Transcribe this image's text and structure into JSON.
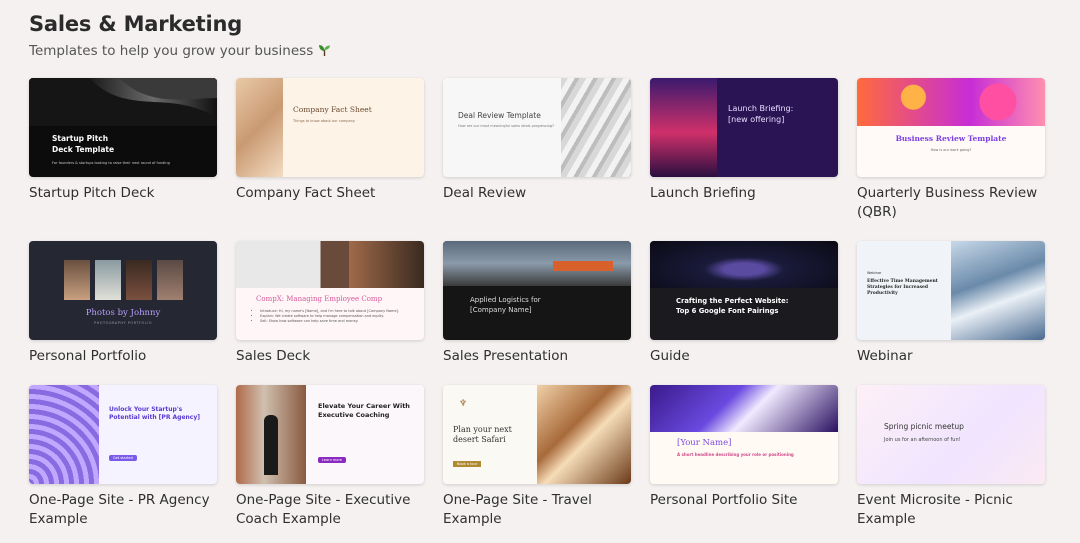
{
  "header": {
    "title": "Sales & Marketing",
    "subtitle": "Templates to help you grow your business",
    "subtitle_icon": "sprout-icon"
  },
  "cards": [
    {
      "label": "Startup Pitch Deck",
      "thumb": {
        "heading": "Startup Pitch\nDeck Template",
        "sub": "For founders & startups looking to raise their next round of funding"
      }
    },
    {
      "label": "Company Fact Sheet",
      "thumb": {
        "heading": "Company Fact Sheet",
        "sub": "Things to know about our company"
      }
    },
    {
      "label": "Deal Review",
      "thumb": {
        "heading": "Deal Review Template",
        "sub": "How are our most meaningful sales deals progressing?"
      }
    },
    {
      "label": "Launch Briefing",
      "thumb": {
        "heading": "Launch Briefing:\n[new offering]"
      }
    },
    {
      "label": "Quarterly Business Review (QBR)",
      "thumb": {
        "heading": "Business Review Template",
        "sub": "How is our work going?"
      }
    },
    {
      "label": "Personal Portfolio",
      "thumb": {
        "heading": "Photos by Johnny",
        "sub": "PHOTOGRAPHY PORTFOLIO"
      }
    },
    {
      "label": "Sales Deck",
      "thumb": {
        "heading": "CompX: Managing Employee Comp",
        "bullets": [
          "Introduce: Hi, my name's [Name], and I'm here to talk about [Company Name].",
          "Explain: We create software to help manage compensation and equity.",
          "Sell: Show how software can help save time and money."
        ]
      }
    },
    {
      "label": "Sales Presentation",
      "thumb": {
        "heading": "Applied Logistics for\n[Company Name]"
      }
    },
    {
      "label": "Guide",
      "thumb": {
        "heading": "Crafting the Perfect Website:\nTop 6 Google Font Pairings"
      }
    },
    {
      "label": "Webinar",
      "thumb": {
        "heading": "Effective Time Management Strategies for Increased Productivity",
        "kicker": "Webinar"
      }
    },
    {
      "label": "One-Page Site - PR Agency Example",
      "thumb": {
        "heading": "Unlock Your Startup's Potential with [PR Agency]",
        "button": "Get started"
      }
    },
    {
      "label": "One-Page Site - Executive Coach Example",
      "thumb": {
        "heading": "Elevate Your Career With Executive Coaching",
        "button": "Learn more"
      }
    },
    {
      "label": "One-Page Site - Travel Example",
      "thumb": {
        "heading": "Plan your next desert Safari",
        "button": "Book a tour"
      }
    },
    {
      "label": "Personal Portfolio Site",
      "thumb": {
        "heading": "[Your Name]",
        "sub": "A short headline describing your role or positioning"
      }
    },
    {
      "label": "Event Microsite - Picnic Example",
      "thumb": {
        "heading": "Spring picnic meetup",
        "sub": "Join us for an afternoon of fun!"
      }
    }
  ]
}
